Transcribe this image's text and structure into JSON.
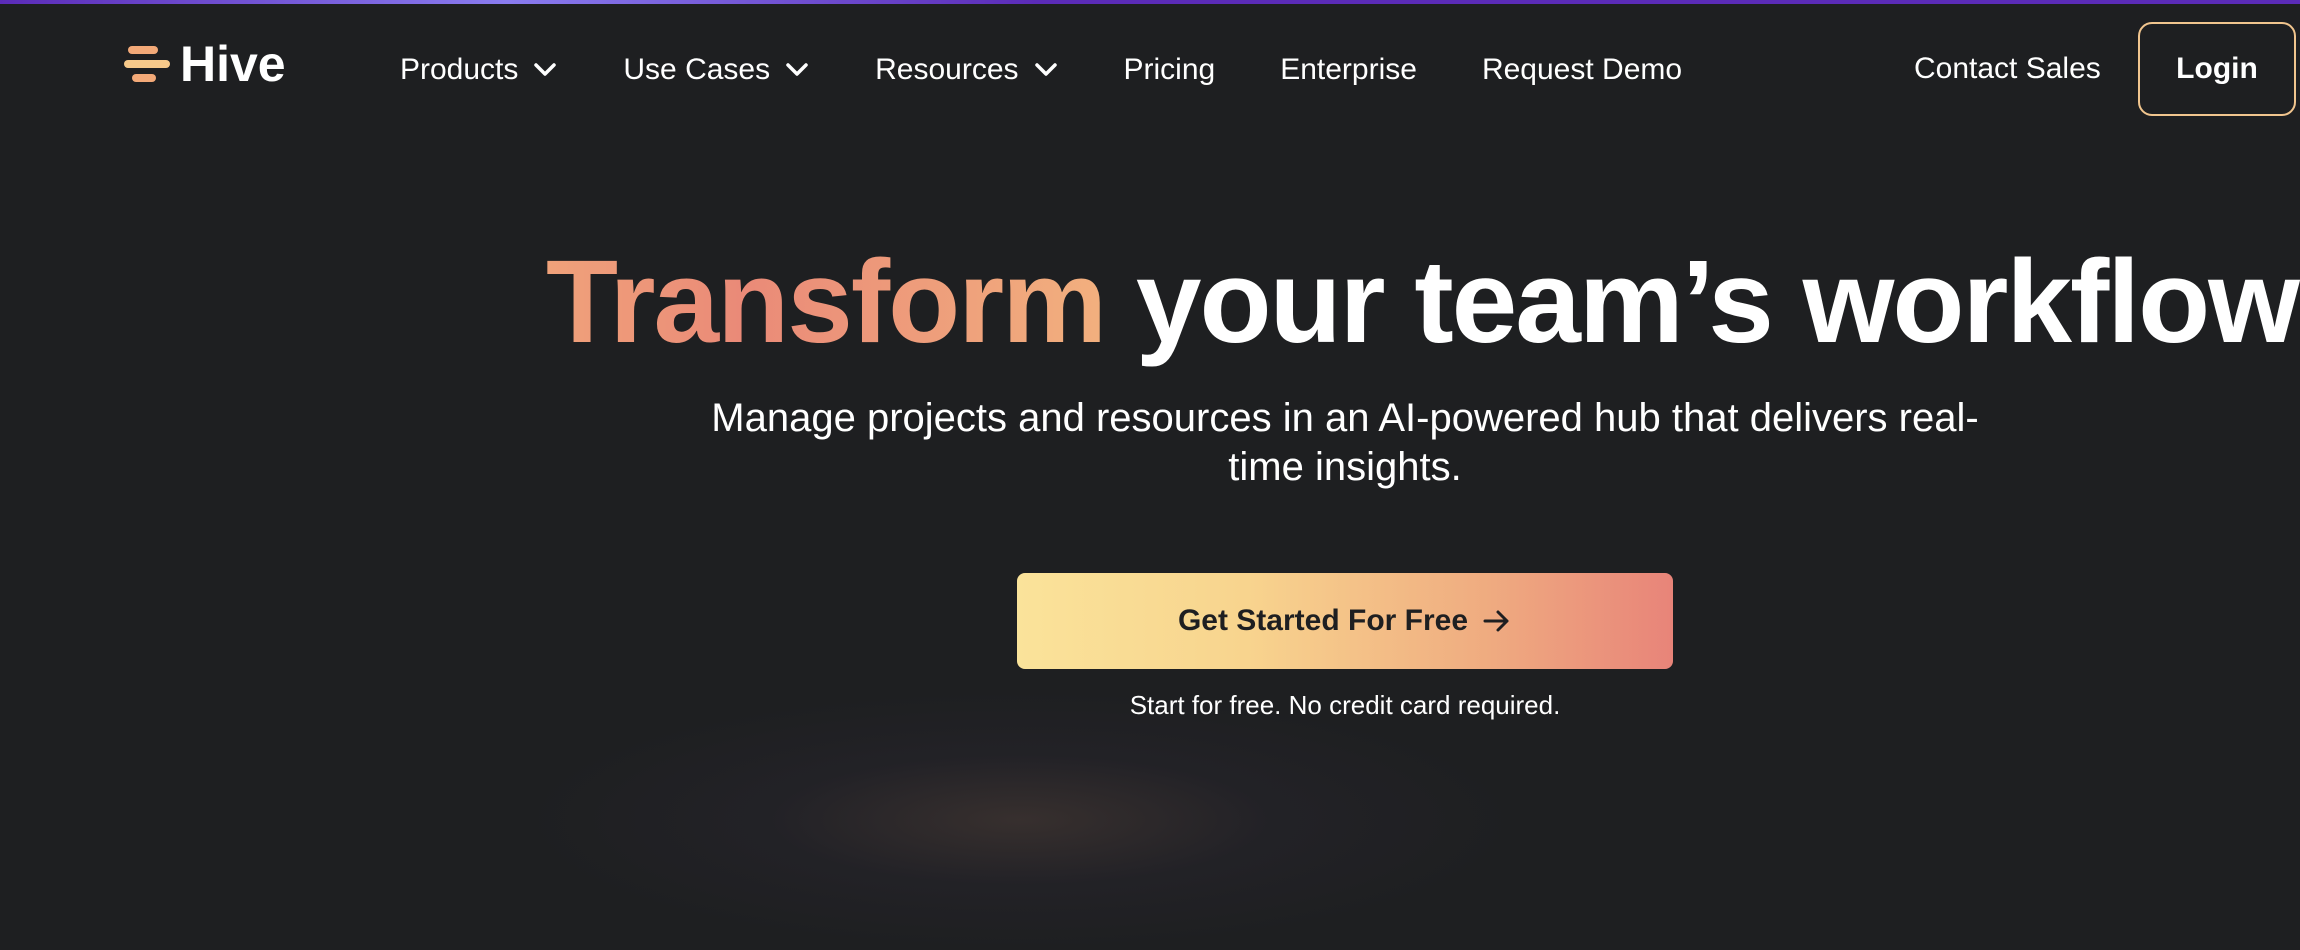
{
  "brand": {
    "name": "Hive",
    "logo_icon": "hive-logo-icon",
    "colors": {
      "background": "#1e1f21",
      "accent_start": "#fae39a",
      "accent_end": "#e88479",
      "login_border": "#f1c58e"
    }
  },
  "nav": {
    "items": [
      {
        "label": "Products",
        "has_dropdown": true
      },
      {
        "label": "Use Cases",
        "has_dropdown": true
      },
      {
        "label": "Resources",
        "has_dropdown": true
      },
      {
        "label": "Pricing",
        "has_dropdown": false
      },
      {
        "label": "Enterprise",
        "has_dropdown": false
      },
      {
        "label": "Request Demo",
        "has_dropdown": false
      }
    ],
    "contact_label": "Contact Sales",
    "login_label": "Login"
  },
  "hero": {
    "title_accent": "Transform",
    "title_rest": " your team’s workflows",
    "subtitle": "Manage projects and resources in an AI-powered hub that delivers real-time insights.",
    "cta_label": "Get Started For Free",
    "cta_icon": "arrow-right-icon",
    "note": "Start for free. No credit card required."
  }
}
